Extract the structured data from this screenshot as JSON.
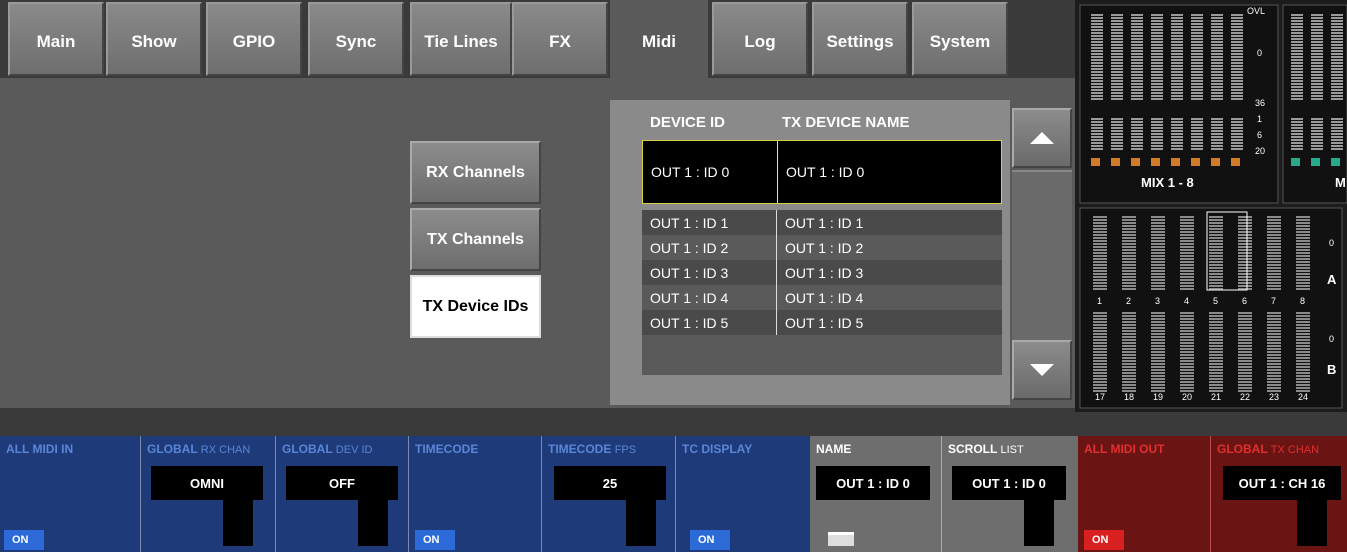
{
  "tabs": [
    "Main",
    "Show",
    "GPIO",
    "Sync",
    "Tie Lines",
    "FX",
    "Midi",
    "Log",
    "Settings",
    "System"
  ],
  "active_tab": "Midi",
  "side_buttons": [
    "RX Channels",
    "TX Channels",
    "TX Device IDs"
  ],
  "active_side_button": "TX Device IDs",
  "table": {
    "headers": [
      "DEVICE ID",
      "TX DEVICE NAME"
    ],
    "rows": [
      [
        "OUT 1 : ID 0",
        "OUT 1 : ID 0"
      ],
      [
        "OUT 1 : ID 1",
        "OUT 1 : ID 1"
      ],
      [
        "OUT 1 : ID 2",
        "OUT 1 : ID 2"
      ],
      [
        "OUT 1 : ID 3",
        "OUT 1 : ID 3"
      ],
      [
        "OUT 1 : ID 4",
        "OUT 1 : ID 4"
      ],
      [
        "OUT 1 : ID 5",
        "OUT 1 : ID 5"
      ]
    ],
    "selected_row": 0
  },
  "meters": {
    "mix_label": "MIX 1 - 8",
    "mix_label2": "M",
    "scale_top": [
      "OVL",
      "0",
      "36",
      "1",
      "6",
      "20"
    ],
    "ab_scale": [
      "0",
      "A",
      "0",
      "B"
    ],
    "channels_top": [
      "1",
      "2",
      "3",
      "4",
      "5",
      "6",
      "7",
      "8"
    ],
    "channels_bottom": [
      "17",
      "18",
      "19",
      "20",
      "21",
      "22",
      "23",
      "24"
    ]
  },
  "bottom": {
    "all_midi_in": {
      "label": "ALL MIDI IN",
      "button": "ON"
    },
    "global_rx_chan": {
      "label": "GLOBAL",
      "sub": "RX CHAN",
      "value": "OMNI"
    },
    "global_dev_id": {
      "label": "GLOBAL",
      "sub": "DEV ID",
      "value": "OFF"
    },
    "timecode": {
      "label": "TIMECODE",
      "button": "ON"
    },
    "timecode_fps": {
      "label": "TIMECODE",
      "sub": "FPS",
      "value": "25"
    },
    "tc_display": {
      "label": "TC DISPLAY",
      "button": "ON"
    },
    "name": {
      "label": "NAME",
      "value": "OUT 1 : ID 0"
    },
    "scroll_list": {
      "label": "SCROLL",
      "sub": "LIST",
      "value": "OUT 1 : ID 0"
    },
    "all_midi_out": {
      "label": "ALL MIDI OUT",
      "button": "ON"
    },
    "global_tx_chan": {
      "label": "GLOBAL",
      "sub": "TX CHAN",
      "value": "OUT 1 : CH 16"
    }
  },
  "colors": {
    "blue_section": "#1e3a78",
    "blue_label": "#5a86d8",
    "grey_section": "#6e6e6e",
    "red_section": "#6a1414",
    "red_label": "#e03030",
    "on_blue": "#2c6ad8",
    "on_red": "#d82020",
    "meter_orange": "#d07a2a",
    "meter_teal": "#2aa88a"
  }
}
